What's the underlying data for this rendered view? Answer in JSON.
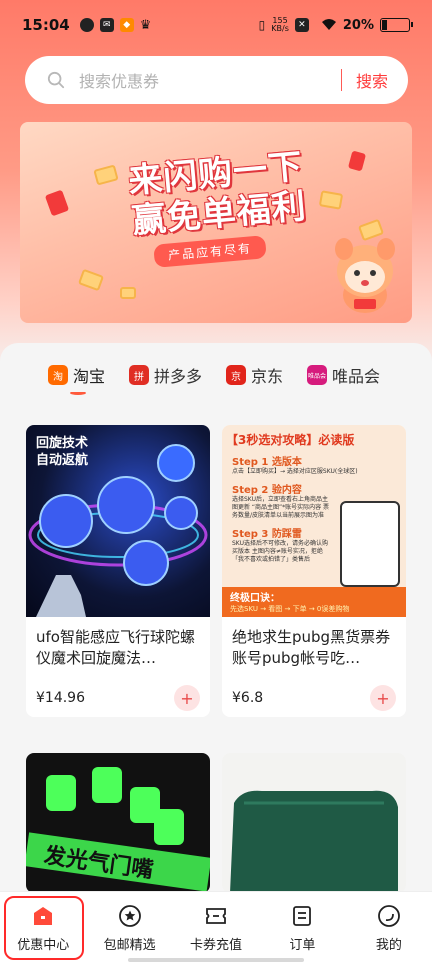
{
  "status_bar": {
    "time": "15:04",
    "net_speed_value": "155",
    "net_speed_unit": "KB/s",
    "battery": "20%"
  },
  "search": {
    "placeholder": "搜索优惠券",
    "button": "搜索"
  },
  "banner": {
    "title_line1": "来闪购一下",
    "title_line2": "赢免单福利",
    "subtitle": "产品应有尽有"
  },
  "platform_tabs": [
    {
      "label": "淘宝",
      "icon": "taobao-icon",
      "icon_text": "淘",
      "color": "#ff6a00"
    },
    {
      "label": "拼多多",
      "icon": "pinduoduo-icon",
      "icon_text": "拼",
      "color": "#e02e24"
    },
    {
      "label": "京东",
      "icon": "jd-icon",
      "icon_text": "京",
      "color": "#e1251b"
    },
    {
      "label": "唯品会",
      "icon": "vip-icon",
      "icon_text": "唯品会",
      "color": "#d61b7d"
    }
  ],
  "products": [
    {
      "title": "ufo智能感应飞行球陀螺仪魔术回旋魔法…",
      "price": "¥14.96",
      "image_text_1": "回旋技术",
      "image_text_2": "自动返航"
    },
    {
      "title": "绝地求生pubg黑货票券账号pubg帐号吃…",
      "price": "¥6.8",
      "image_header": "【3秒选对攻略】必读版",
      "steps": [
        {
          "title": "Step 1 选版本",
          "text": "点击【立即购买】→ 选择对应区服SKU(全球区)"
        },
        {
          "title": "Step 2 验内容",
          "text": "选择SKU后，立即查看右上角商品主图更新 “商品主图”*账号实际内容 票务数量/皮肤清单以当前展示图为准"
        },
        {
          "title": "Step 3 防踩雷",
          "text": "SKU选择后不可修改，请务必确认购买版本 主图内容≠账号实况，拒绝「我不喜欢或拍错了」类售后"
        }
      ],
      "footer_title": "终极口诀：",
      "footer_text": "先选SKU → 看图 → 下单 → 0误差购物"
    },
    {
      "title": "",
      "price": "",
      "image_text_1": "发光气门嘴"
    },
    {
      "title": "",
      "price": ""
    }
  ],
  "bottom_nav": [
    {
      "label": "优惠中心",
      "icon": "coupon-home-icon"
    },
    {
      "label": "包邮精选",
      "icon": "star-circle-icon"
    },
    {
      "label": "卡券充值",
      "icon": "ticket-icon"
    },
    {
      "label": "订单",
      "icon": "order-list-icon"
    },
    {
      "label": "我的",
      "icon": "profile-icon"
    }
  ],
  "colors": {
    "accent": "#ff3b3b",
    "header_gradient_top": "#ff7a68",
    "highlight_box": "#ff2a2a"
  }
}
